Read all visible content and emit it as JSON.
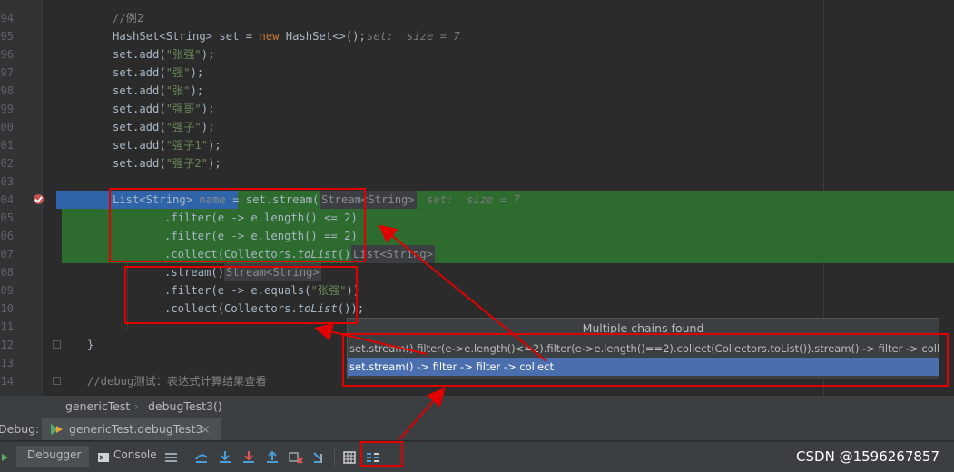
{
  "editor": {
    "lines": [
      {
        "num": "94",
        "text": "//例2"
      },
      {
        "num": "95",
        "text": "HashSet<String> set = new HashSet<>();",
        "hint": "set:  size = 7"
      },
      {
        "num": "96",
        "text": "set.add(\"张强\");"
      },
      {
        "num": "97",
        "text": "set.add(\"强\");"
      },
      {
        "num": "98",
        "text": "set.add(\"张\");"
      },
      {
        "num": "99",
        "text": "set.add(\"强哥\");"
      },
      {
        "num": "00",
        "text": "set.add(\"强子\");"
      },
      {
        "num": "01",
        "text": "set.add(\"强子1\");"
      },
      {
        "num": "02",
        "text": "set.add(\"强子2\");"
      },
      {
        "num": "03",
        "text": ""
      },
      {
        "num": "04",
        "text": "List<String> name = set.stream()",
        "inlay": "Stream<String>",
        "hint": "set:  size = 7"
      },
      {
        "num": "05",
        "text": ".filter(e -> e.length() <= 2)"
      },
      {
        "num": "06",
        "text": ".filter(e -> e.length() == 2)"
      },
      {
        "num": "07",
        "text": ".collect(Collectors.toList())",
        "inlay": "List<String>"
      },
      {
        "num": "08",
        "text": ".stream()",
        "inlay": "Stream<String>"
      },
      {
        "num": "09",
        "text": ".filter(e -> e.equals(\"张强\"))"
      },
      {
        "num": "10",
        "text": ".collect(Collectors.toList());"
      },
      {
        "num": "11",
        "text": ""
      },
      {
        "num": "12",
        "text": "}"
      },
      {
        "num": "13",
        "text": ""
      },
      {
        "num": "14",
        "text": "//debug测试：表达式计算结果查看"
      }
    ]
  },
  "popup": {
    "title": "Multiple chains found",
    "items": [
      "set.stream().filter(e->e.length()<=2).filter(e->e.length()==2).collect(Collectors.toList()).stream() -> filter -> collect",
      "set.stream() -> filter -> filter -> collect"
    ],
    "selected_index": 1
  },
  "breadcrumb": {
    "items": [
      "genericTest",
      "debugTest3()"
    ],
    "separator": "›"
  },
  "debug_bar": {
    "label": "Debug:",
    "tab": "genericTest.debugTest3",
    "close": "×"
  },
  "toolbar": {
    "tabs": [
      "Debugger",
      "Console"
    ]
  },
  "watermark": "CSDN @1596267857",
  "colors": {
    "annotation": "#e00000",
    "exec_line": "#2e6b2e",
    "selection": "#2f65a8",
    "popup_selected": "#4b6eaf"
  }
}
